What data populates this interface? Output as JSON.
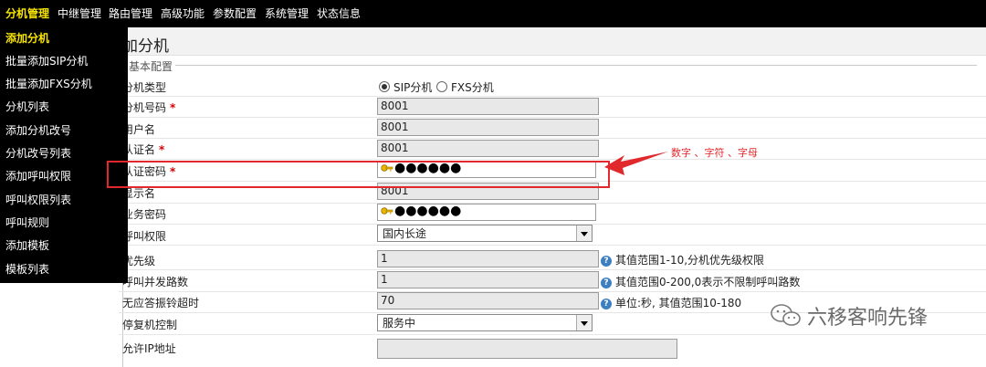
{
  "nav": {
    "items": [
      "分机管理",
      "中继管理",
      "路由管理",
      "高级功能",
      "参数配置",
      "系统管理",
      "状态信息"
    ]
  },
  "sidebar": {
    "items": [
      "添加分机",
      "批量添加SIP分机",
      "批量添加FXS分机",
      "分机列表",
      "添加分机改号",
      "分机改号列表",
      "添加呼叫权限",
      "呼叫权限列表",
      "呼叫规则",
      "添加模板",
      "模板列表"
    ]
  },
  "page": {
    "title": "加分机",
    "legend": "基本配置"
  },
  "form": {
    "ext_type_label": "分机类型",
    "ext_type_options": [
      "SIP分机",
      "FXS分机"
    ],
    "ext_number_label": "分机号码",
    "ext_number_value": "8001",
    "username_label": "用户名",
    "username_value": "8001",
    "auth_name_label": "认证名",
    "auth_name_value": "8001",
    "auth_pwd_label": "认证密码",
    "auth_pwd_value": "●●●●●●",
    "display_label": "显示名",
    "display_value": "8001",
    "service_pwd_label": "业务密码",
    "service_pwd_value": "●●●●●●",
    "call_perm_label": "呼叫权限",
    "call_perm_value": "国内长途",
    "priority_label": "优先级",
    "priority_value": "1",
    "priority_help": "其值范围1-10,分机优先级权限",
    "concurrent_label": "呼叫并发路数",
    "concurrent_value": "1",
    "concurrent_help": "其值范围0-200,0表示不限制呼叫路数",
    "no_answer_label": "无应答振铃超时",
    "no_answer_value": "70",
    "no_answer_help": "单位:秒, 其值范围10-180",
    "suspend_label": "停复机控制",
    "suspend_value": "服务中",
    "allowed_ip_label": "允许IP地址",
    "required_mark": "*"
  },
  "annotation": {
    "note": "数字 、字符 、字母"
  },
  "watermark": {
    "text": "六移客响先锋"
  },
  "colors": {
    "nav_bg": "#000000",
    "nav_active": "#f7e400",
    "highlight": "#e0282d",
    "help_icon": "#3d7fc1"
  }
}
